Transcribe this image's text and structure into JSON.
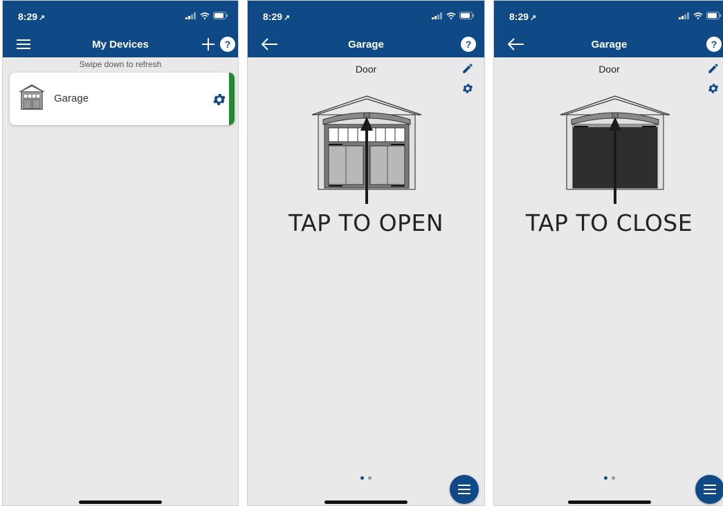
{
  "status": {
    "time": "8:29",
    "location_glyph": "↗"
  },
  "screen1": {
    "title": "My Devices",
    "hint": "Swipe down to refresh",
    "devices": [
      {
        "name": "Garage",
        "status_color": "#1f8a2e"
      }
    ]
  },
  "screen2": {
    "title": "Garage",
    "door_label": "Door",
    "action": "TAP TO OPEN",
    "door_state": "closed"
  },
  "screen3": {
    "title": "Garage",
    "door_label": "Door",
    "action": "TAP TO CLOSE",
    "door_state": "open"
  },
  "help_label": "?",
  "pager": {
    "pages": 2,
    "active": 1
  },
  "colors": {
    "brand": "#0f4a87",
    "online": "#1f8a2e",
    "background": "#e9e9e9"
  },
  "icons": [
    "menu-icon",
    "plus-icon",
    "help-icon",
    "gear-icon",
    "back-arrow-icon",
    "pencil-icon",
    "garage-door-icon"
  ]
}
